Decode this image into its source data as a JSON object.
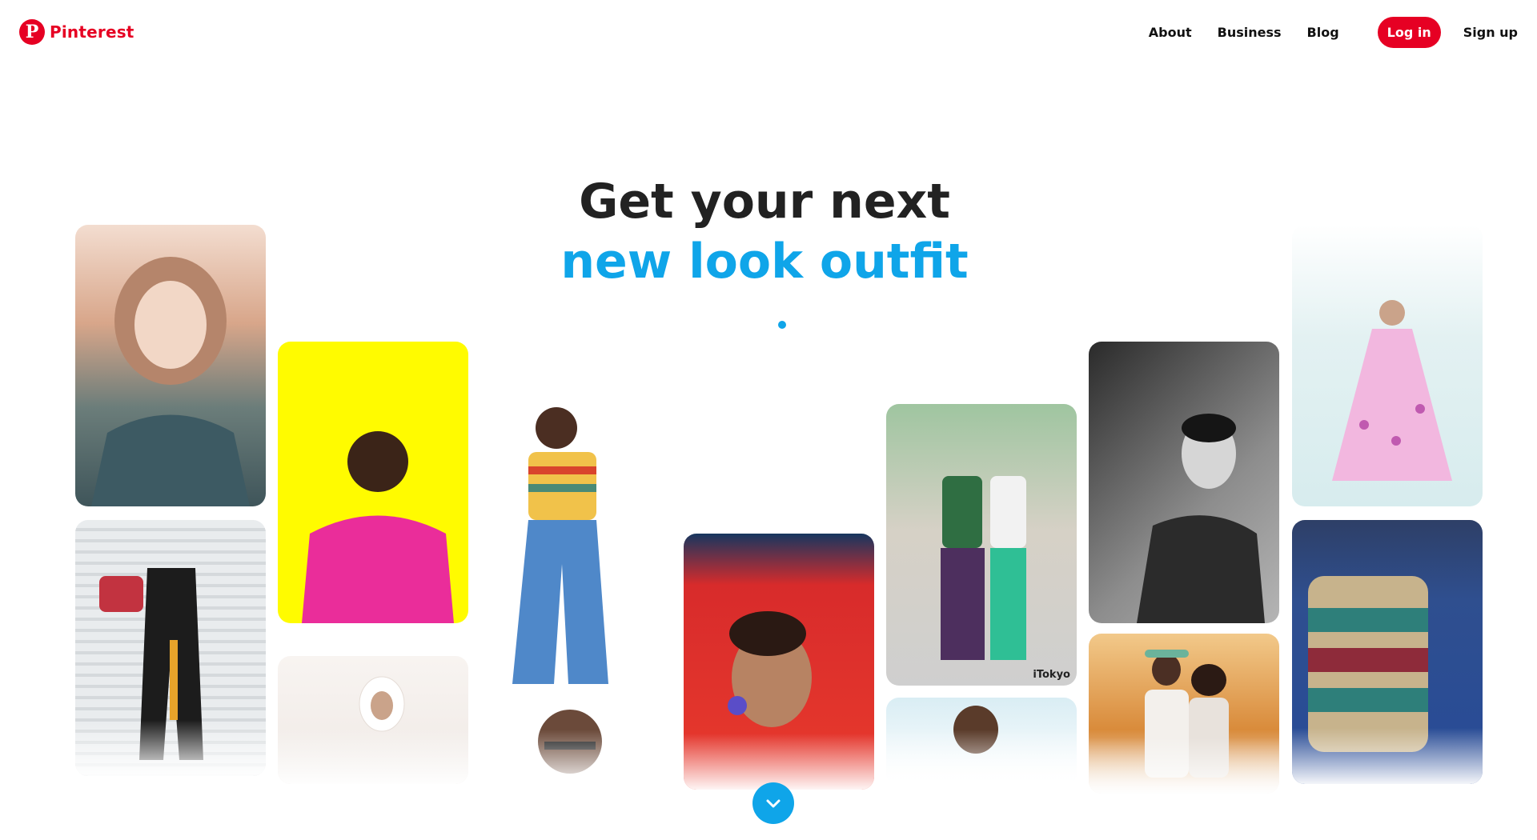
{
  "brand": {
    "name": "Pinterest",
    "color": "#e60023"
  },
  "nav": {
    "about": "About",
    "business": "Business",
    "blog": "Blog",
    "login": "Log in",
    "signup": "Sign up"
  },
  "hero": {
    "line1": "Get your next",
    "line2": "new look outfit",
    "accent_color": "#0fa5e9"
  },
  "gallery": {
    "tile_tag": "iTokyo"
  },
  "icons": {
    "scroll": "chevron-down-icon",
    "logo": "pinterest-logo-icon"
  }
}
